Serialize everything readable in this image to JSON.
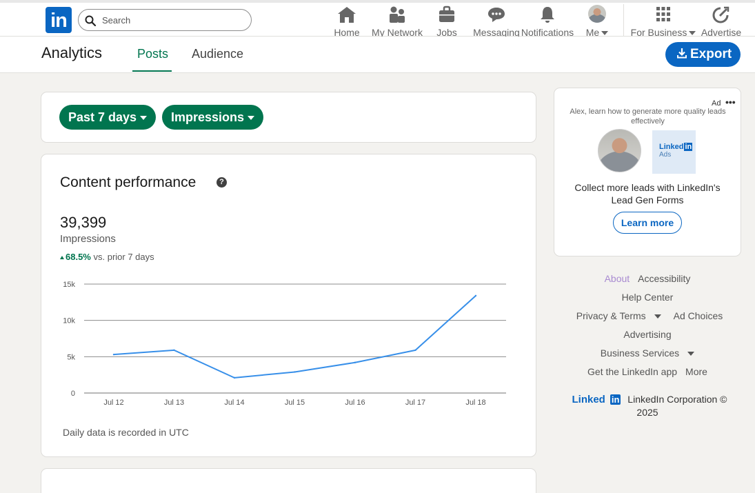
{
  "nav": {
    "logo": "in",
    "search_placeholder": "Search",
    "items": [
      {
        "label": "Home",
        "icon": "home-icon"
      },
      {
        "label": "My Network",
        "icon": "network-icon"
      },
      {
        "label": "Jobs",
        "icon": "briefcase-icon"
      },
      {
        "label": "Messaging",
        "icon": "message-icon"
      },
      {
        "label": "Notifications",
        "icon": "bell-icon"
      },
      {
        "label": "Me",
        "icon": "avatar"
      },
      {
        "label": "For Business",
        "icon": "grid-icon"
      },
      {
        "label": "Advertise",
        "icon": "advertise-icon"
      }
    ]
  },
  "subheader": {
    "title": "Analytics",
    "tabs": [
      {
        "label": "Posts",
        "active": true
      },
      {
        "label": "Audience",
        "active": false
      }
    ],
    "export_label": "Export"
  },
  "filters": {
    "range": "Past 7 days",
    "metric": "Impressions"
  },
  "performance": {
    "title": "Content performance",
    "help_glyph": "?",
    "total": "39,399",
    "metric_label": "Impressions",
    "delta_pct": "68.5%",
    "delta_text": "vs. prior 7 days",
    "footnote": "Daily data is recorded in UTC"
  },
  "chart_data": {
    "type": "line",
    "x": [
      "Jul 12",
      "Jul 13",
      "Jul 14",
      "Jul 15",
      "Jul 16",
      "Jul 17",
      "Jul 18"
    ],
    "values": [
      5300,
      5900,
      2100,
      2900,
      4200,
      5900,
      13400
    ],
    "yticks": [
      0,
      5000,
      10000,
      15000
    ],
    "yticklabels": [
      "0",
      "5k",
      "10k",
      "15k"
    ],
    "ylim": [
      0,
      15000
    ],
    "line_color": "#378fe9",
    "grid_color": "#8c8c8c"
  },
  "ad": {
    "label": "Ad",
    "menu_glyph": "•••",
    "pitch": "Alex, learn how to generate more quality leads effectively",
    "brand_name": "Linked",
    "brand_in": "in",
    "brand_sub": "Ads",
    "headline": "Collect more leads with LinkedIn's Lead Gen Forms",
    "cta": "Learn more"
  },
  "footer": {
    "about": "About",
    "accessibility": "Accessibility",
    "help_center": "Help Center",
    "privacy_terms": "Privacy & Terms",
    "ad_choices": "Ad Choices",
    "advertising": "Advertising",
    "business_services": "Business Services",
    "get_app": "Get the LinkedIn app",
    "more": "More",
    "logo_text": "Linked",
    "logo_in": "in",
    "copyright": "LinkedIn Corporation © 2025"
  },
  "colors": {
    "brand_blue": "#0a66c2",
    "green": "#01754f",
    "background": "#f3f2ef"
  }
}
